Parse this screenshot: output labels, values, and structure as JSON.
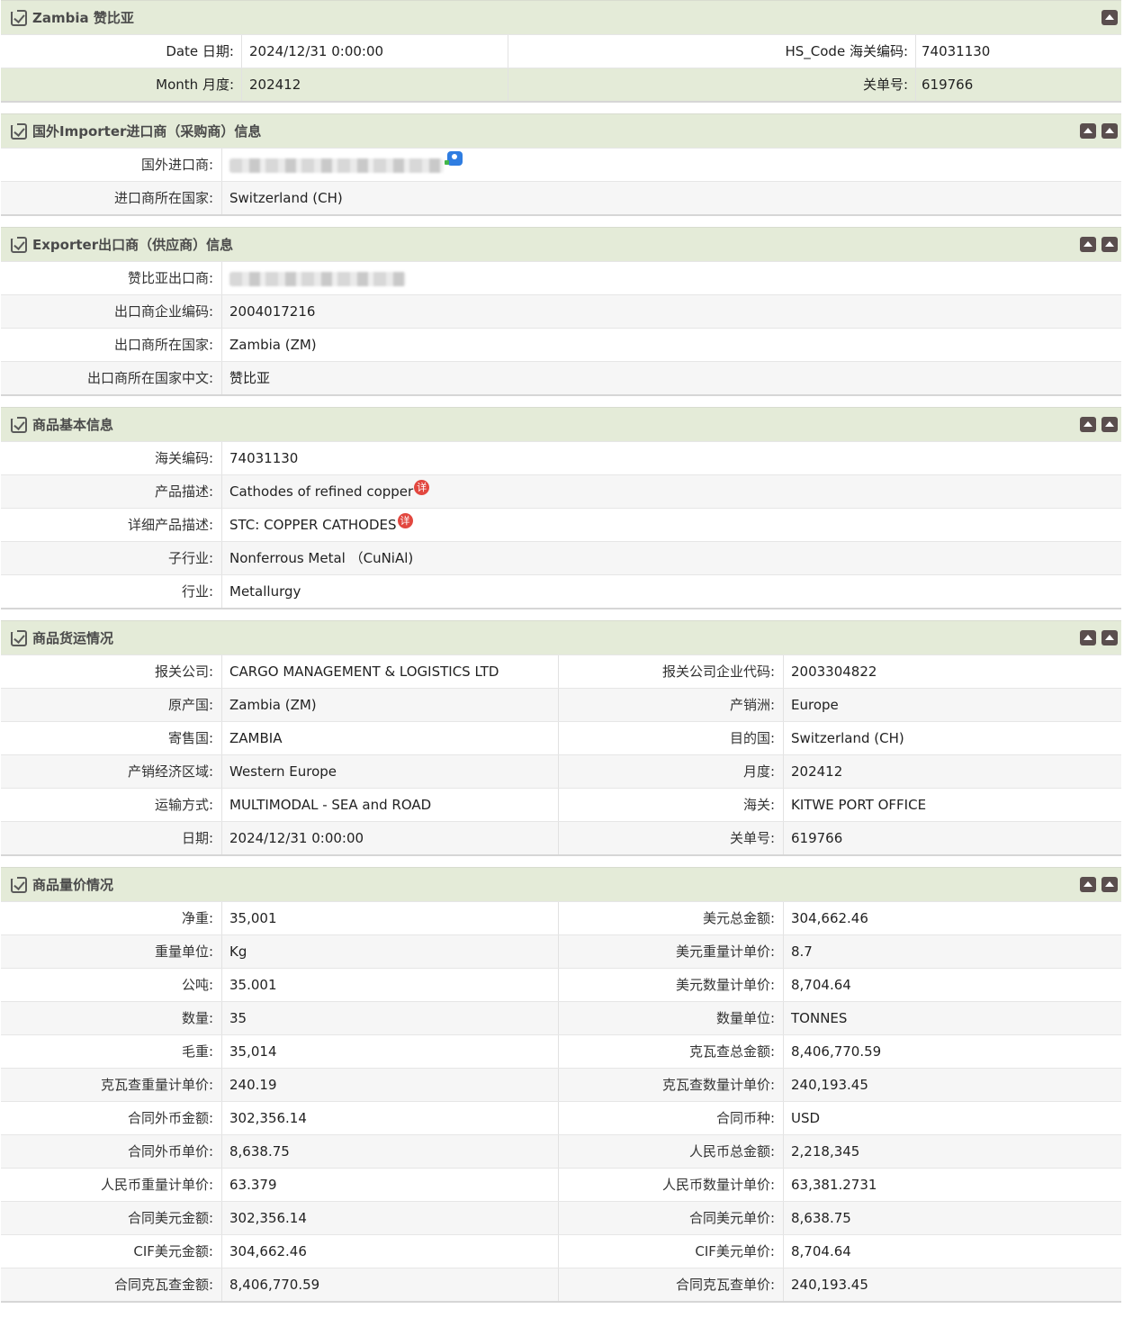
{
  "basic": {
    "title": "Zambia 赞比亚",
    "rows": [
      {
        "l1": "Date 日期:",
        "v1": "2024/12/31 0:00:00",
        "l2": "HS_Code 海关编码:",
        "v2": "74031130"
      },
      {
        "l1": "Month 月度:",
        "v1": "202412",
        "l2": "关单号:",
        "v2": "619766"
      }
    ]
  },
  "importer": {
    "title": "国外Importer进口商（采购商）信息",
    "rows": [
      {
        "label": "国外进口商:",
        "value": ""
      },
      {
        "label": "进口商所在国家:",
        "value": "Switzerland (CH)"
      }
    ]
  },
  "exporter": {
    "title": "Exporter出口商（供应商）信息",
    "rows": [
      {
        "label": "赞比亚出口商:",
        "value": ""
      },
      {
        "label": "出口商企业编码:",
        "value": "2004017216"
      },
      {
        "label": "出口商所在国家:",
        "value": "Zambia (ZM)"
      },
      {
        "label": "出口商所在国家中文:",
        "value": "赞比亚"
      }
    ]
  },
  "product": {
    "title": "商品基本信息",
    "detail_badge": "详",
    "rows": [
      {
        "label": "海关编码:",
        "value": "74031130"
      },
      {
        "label": "产品描述:",
        "value": "Cathodes of refined copper"
      },
      {
        "label": "详细产品描述:",
        "value": "STC: COPPER CATHODES"
      },
      {
        "label": "子行业:",
        "value": "Nonferrous Metal （CuNiAl)"
      },
      {
        "label": "行业:",
        "value": "Metallurgy"
      }
    ]
  },
  "shipping": {
    "title": "商品货运情况",
    "rows": [
      {
        "l1": "报关公司:",
        "v1": "CARGO MANAGEMENT & LOGISTICS LTD",
        "l2": "报关公司企业代码:",
        "v2": "2003304822"
      },
      {
        "l1": "原产国:",
        "v1": "Zambia (ZM)",
        "l2": "产销洲:",
        "v2": "Europe"
      },
      {
        "l1": "寄售国:",
        "v1": "ZAMBIA",
        "l2": "目的国:",
        "v2": "Switzerland (CH)"
      },
      {
        "l1": "产销经济区域:",
        "v1": "Western Europe",
        "l2": "月度:",
        "v2": "202412"
      },
      {
        "l1": "运输方式:",
        "v1": "MULTIMODAL - SEA and ROAD",
        "l2": "海关:",
        "v2": "KITWE PORT OFFICE"
      },
      {
        "l1": "日期:",
        "v1": "2024/12/31 0:00:00",
        "l2": "关单号:",
        "v2": "619766"
      }
    ]
  },
  "pricing": {
    "title": "商品量价情况",
    "rows": [
      {
        "l1": "净重:",
        "v1": "35,001",
        "l2": "美元总金额:",
        "v2": "304,662.46"
      },
      {
        "l1": "重量单位:",
        "v1": "Kg",
        "l2": "美元重量计单价:",
        "v2": "8.7"
      },
      {
        "l1": "公吨:",
        "v1": "35.001",
        "l2": "美元数量计单价:",
        "v2": "8,704.64"
      },
      {
        "l1": "数量:",
        "v1": "35",
        "l2": "数量单位:",
        "v2": "TONNES"
      },
      {
        "l1": "毛重:",
        "v1": "35,014",
        "l2": "克瓦查总金额:",
        "v2": "8,406,770.59"
      },
      {
        "l1": "克瓦查重量计单价:",
        "v1": "240.19",
        "l2": "克瓦查数量计单价:",
        "v2": "240,193.45"
      },
      {
        "l1": "合同外币金额:",
        "v1": "302,356.14",
        "l2": "合同币种:",
        "v2": "USD"
      },
      {
        "l1": "合同外币单价:",
        "v1": "8,638.75",
        "l2": "人民币总金额:",
        "v2": "2,218,345"
      },
      {
        "l1": "人民币重量计单价:",
        "v1": "63.379",
        "l2": "人民币数量计单价:",
        "v2": "63,381.2731"
      },
      {
        "l1": "合同美元金额:",
        "v1": "302,356.14",
        "l2": "合同美元单价:",
        "v2": "8,638.75"
      },
      {
        "l1": "CIF美元金额:",
        "v1": "304,662.46",
        "l2": "CIF美元单价:",
        "v2": "8,704.64"
      },
      {
        "l1": "合同克瓦查金额:",
        "v1": "8,406,770.59",
        "l2": "合同克瓦查单价:",
        "v2": "240,193.45"
      }
    ]
  }
}
